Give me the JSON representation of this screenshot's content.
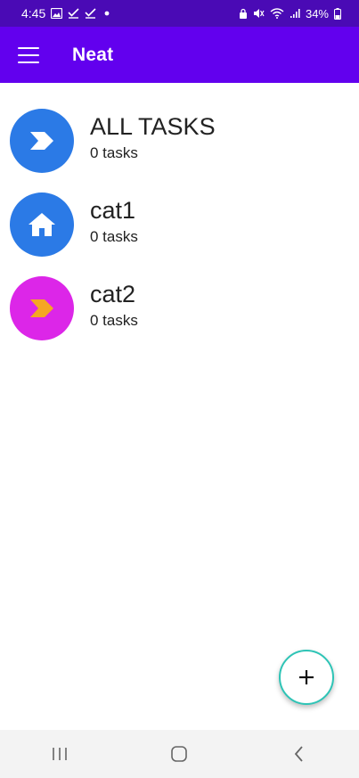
{
  "status_bar": {
    "time": "4:45",
    "battery": "34%",
    "left_icons": [
      "image-icon",
      "check-icon",
      "check-icon",
      "dot-icon"
    ],
    "right_icons": [
      "lock-icon",
      "mute-icon",
      "wifi-icon",
      "signal-icon",
      "battery-icon"
    ]
  },
  "app_bar": {
    "title": "Neat",
    "menu_icon": "hamburger-menu-icon"
  },
  "categories": [
    {
      "name": "ALL TASKS",
      "count": "0 tasks",
      "icon": "chevron-right-icon",
      "bg_color": "#2b7ae6",
      "icon_color": "#ffffff"
    },
    {
      "name": "cat1",
      "count": "0 tasks",
      "icon": "home-icon",
      "bg_color": "#2b7ae6",
      "icon_color": "#ffffff"
    },
    {
      "name": "cat2",
      "count": "0 tasks",
      "icon": "chevron-right-icon",
      "bg_color": "#dc26e8",
      "icon_color": "#f5a623"
    }
  ],
  "fab": {
    "icon": "plus-icon",
    "border_color": "#2ec4b6"
  },
  "nav_bar": {
    "buttons": [
      "recents-icon",
      "home-nav-icon",
      "back-icon"
    ]
  },
  "colors": {
    "status_bar": "#4a0ab5",
    "app_bar": "#6200ee",
    "background": "#ffffff",
    "nav_bar": "#f3f3f3"
  }
}
